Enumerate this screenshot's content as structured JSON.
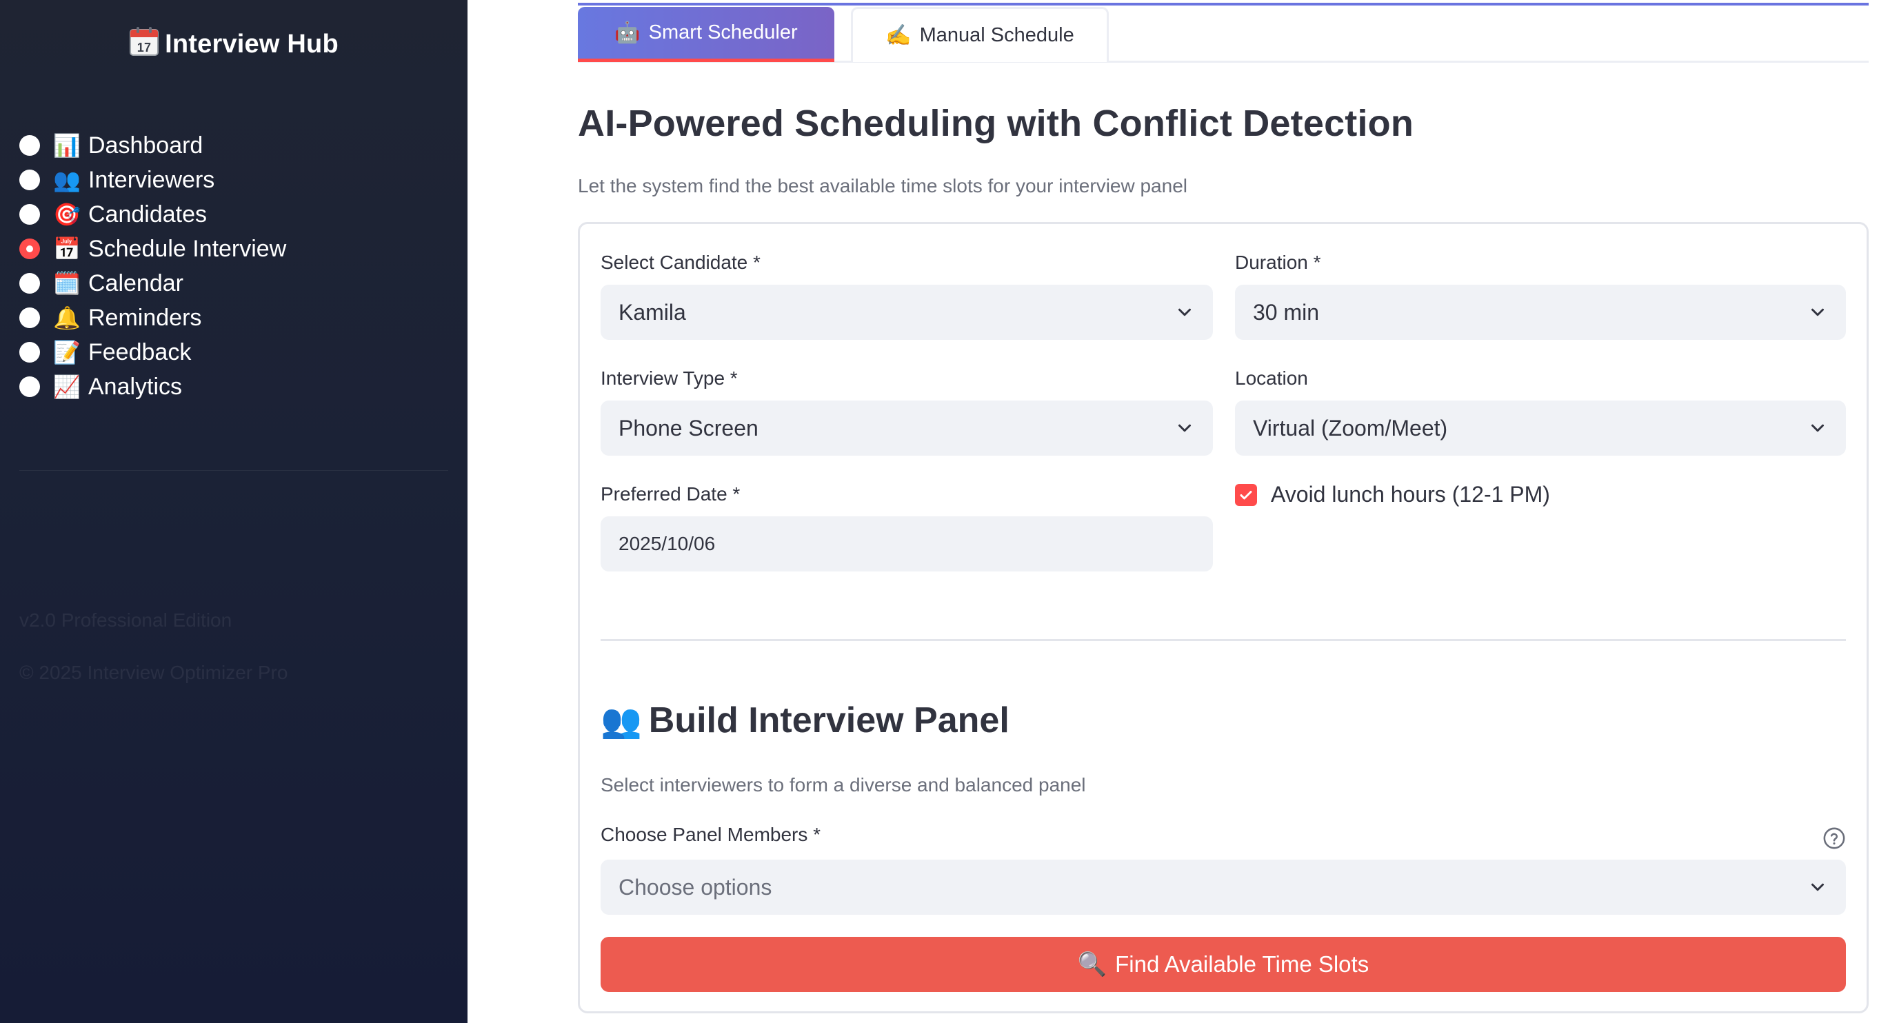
{
  "sidebar": {
    "brand": {
      "icon": "calendar-icon",
      "title": "Interview Hub"
    },
    "items": [
      {
        "label": "Dashboard",
        "icon": "📊",
        "icon_name": "bar-chart-icon",
        "active": false
      },
      {
        "label": "Interviewers",
        "icon": "👥",
        "icon_name": "people-icon",
        "active": false
      },
      {
        "label": "Candidates",
        "icon": "🎯",
        "icon_name": "target-icon",
        "active": false
      },
      {
        "label": "Schedule Interview",
        "icon": "📅",
        "icon_name": "calendar-icon",
        "active": true
      },
      {
        "label": "Calendar",
        "icon": "🗓️",
        "icon_name": "spiral-calendar-icon",
        "active": false
      },
      {
        "label": "Reminders",
        "icon": "🔔",
        "icon_name": "bell-icon",
        "active": false
      },
      {
        "label": "Feedback",
        "icon": "📝",
        "icon_name": "memo-icon",
        "active": false
      },
      {
        "label": "Analytics",
        "icon": "📈",
        "icon_name": "trend-chart-icon",
        "active": false
      }
    ],
    "version": "v2.0 Professional Edition",
    "copyright": "© 2025 Interview Optimizer Pro"
  },
  "tabs": [
    {
      "label": "Smart Scheduler",
      "icon": "🤖",
      "icon_name": "robot-icon",
      "active": true
    },
    {
      "label": "Manual Schedule",
      "icon": "✍️",
      "icon_name": "writing-hand-icon",
      "active": false
    }
  ],
  "main": {
    "title": "AI-Powered Scheduling with Conflict Detection",
    "subtitle": "Let the system find the best available time slots for your interview panel"
  },
  "form": {
    "candidate": {
      "label": "Select Candidate *",
      "value": "Kamila"
    },
    "duration": {
      "label": "Duration *",
      "value": "30 min"
    },
    "interview_type": {
      "label": "Interview Type *",
      "value": "Phone Screen"
    },
    "location": {
      "label": "Location",
      "value": "Virtual (Zoom/Meet)"
    },
    "preferred_date": {
      "label": "Preferred Date *",
      "value": "2025/10/06"
    },
    "avoid_lunch": {
      "label": "Avoid lunch hours (12-1 PM)",
      "checked": true
    }
  },
  "panel": {
    "title": "Build Interview Panel",
    "icon": "👥",
    "subtitle": "Select interviewers to form a diverse and balanced panel",
    "members_label": "Choose Panel Members *",
    "members_placeholder": "Choose options",
    "help_icon": "question-circle-icon"
  },
  "actions": {
    "find_slots": {
      "label": "Find Available Time Slots",
      "icon": "🔍",
      "icon_name": "magnifier-icon"
    }
  },
  "colors": {
    "accent_red": "#ff4b4b",
    "button_red": "#ed5b50",
    "tab_gradient_start": "#6878e0",
    "tab_gradient_end": "#7a64c6",
    "sidebar_bg": "#1b2236"
  }
}
